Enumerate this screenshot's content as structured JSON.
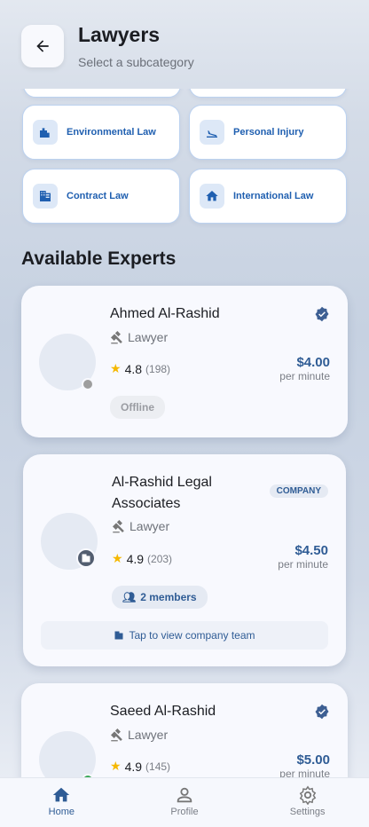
{
  "header": {
    "title": "Lawyers",
    "subtitle": "Select a subcategory",
    "back_icon": "arrow-left-icon"
  },
  "categories": [
    {
      "label": "Environmental Law",
      "icon": "eco-building-icon"
    },
    {
      "label": "Personal Injury",
      "icon": "flight-land-icon"
    },
    {
      "label": "Contract Law",
      "icon": "business-icon"
    },
    {
      "label": "International Law",
      "icon": "home-icon"
    }
  ],
  "section_title": "Available Experts",
  "experts": [
    {
      "name": "Ahmed Al-Rashid",
      "role": "Lawyer",
      "rating": "4.8",
      "reviews": "(198)",
      "price": "$4.00",
      "unit": "per minute",
      "status": "Offline",
      "verified": true
    },
    {
      "name": "Al-Rashid Legal Associates",
      "role": "Lawyer",
      "rating": "4.9",
      "reviews": "(203)",
      "price": "$4.50",
      "unit": "per minute",
      "badge": "COMPANY",
      "members": "2 members",
      "team_link": "Tap to view company team"
    },
    {
      "name": "Saeed Al-Rashid",
      "role": "Lawyer",
      "rating": "4.9",
      "reviews": "(145)",
      "price": "$5.00",
      "unit": "per minute",
      "verified": true
    }
  ],
  "nav": [
    {
      "label": "Home",
      "icon": "home-icon",
      "active": true
    },
    {
      "label": "Profile",
      "icon": "person-icon"
    },
    {
      "label": "Settings",
      "icon": "gear-icon"
    }
  ],
  "colors": {
    "accent": "#2f5c95",
    "category_text": "#1f5fb0",
    "star": "#f5b800",
    "online": "#3aa757",
    "offline": "#9e9e9e"
  }
}
